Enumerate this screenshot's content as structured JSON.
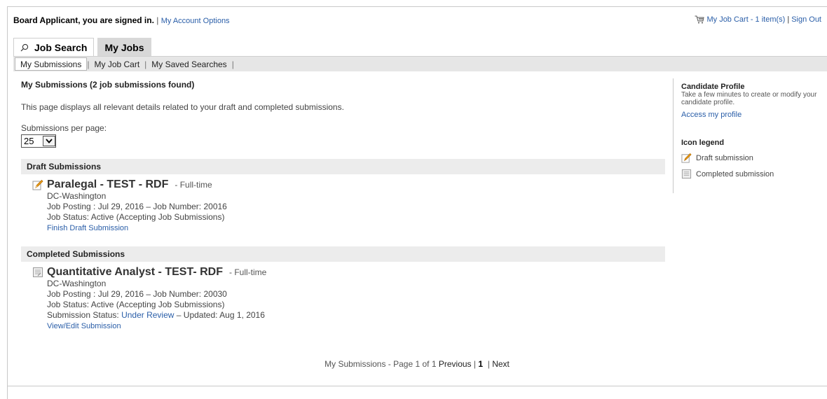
{
  "header": {
    "signed_in_text": "Board Applicant, you are signed in.",
    "separator": "|",
    "account_options": "My Account Options",
    "job_cart": "My Job Cart - 1 item(s)",
    "sign_out": "Sign Out"
  },
  "tabs": {
    "job_search": "Job Search",
    "my_jobs": "My Jobs"
  },
  "subtabs": {
    "my_submissions": "My Submissions",
    "my_job_cart": "My Job Cart",
    "my_saved_searches": "My Saved Searches",
    "sep": "|"
  },
  "main": {
    "title": "My Submissions (2 job submissions found)",
    "description": "This page displays all relevant details related to your draft and completed submissions.",
    "per_page_label": "Submissions per page:",
    "per_page_value": "25"
  },
  "draft": {
    "section_title": "Draft Submissions",
    "job": {
      "title": "Paralegal - TEST - RDF",
      "type": "- Full-time",
      "location": "DC-Washington",
      "posting": "Job Posting : Jul 29, 2016 – Job Number: 20016",
      "status": "Job Status: Active (Accepting Job Submissions)",
      "action": "Finish Draft Submission"
    }
  },
  "completed": {
    "section_title": "Completed Submissions",
    "job": {
      "title": "Quantitative Analyst - TEST- RDF",
      "type": "- Full-time",
      "location": "DC-Washington",
      "posting": "Job Posting : Jul 29, 2016 – Job Number: 20030",
      "status": "Job Status: Active (Accepting Job Submissions)",
      "submission_label": "Submission Status:",
      "submission_status": "Under Review",
      "updated": "– Updated: Aug 1, 2016",
      "action": "View/Edit Submission"
    }
  },
  "pager": {
    "prefix": "My Submissions - Page 1 of 1",
    "previous": "Previous",
    "sep1": "|",
    "current": "1",
    "sep2": "|",
    "next": "Next"
  },
  "sidebar": {
    "profile_title": "Candidate Profile",
    "profile_text": "Take a few minutes to create or modify your candidate profile.",
    "profile_link": "Access my profile",
    "legend_title": "Icon legend",
    "legend_draft": "Draft submission",
    "legend_completed": "Completed submission"
  },
  "icons": {
    "cart": "cart-icon",
    "search": "search-icon",
    "draft": "pencil-icon",
    "completed": "document-icon"
  },
  "colors": {
    "link": "#2a5ea8",
    "tab_active": "#d8d8d8",
    "section_bar": "#ececec"
  }
}
